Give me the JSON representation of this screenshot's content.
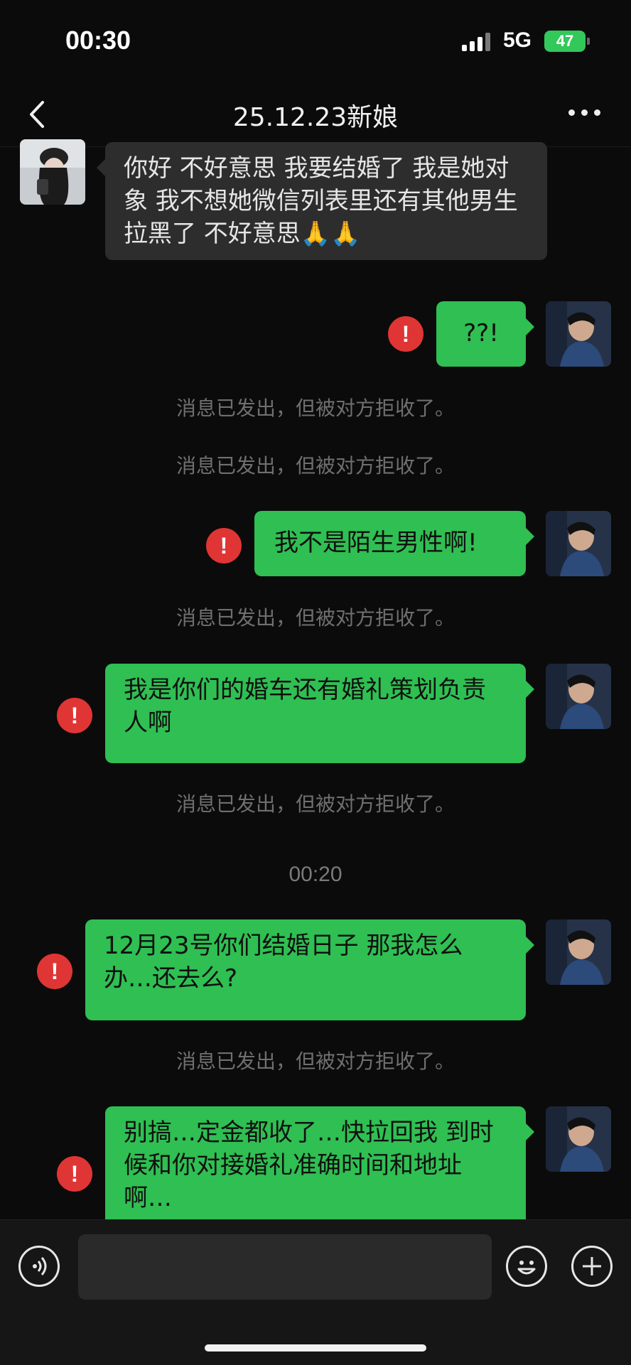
{
  "status_bar": {
    "time": "00:30",
    "network": "5G",
    "battery": "47"
  },
  "nav": {
    "title": "25.12.23新娘"
  },
  "messages": [
    {
      "side": "in",
      "text": "你好 不好意思 我要结婚了 我是她对象 我不想她微信列表里还有其他男生 拉黑了 不好意思🙏🙏"
    },
    {
      "side": "out",
      "text": "??!",
      "failed": true
    },
    {
      "system": "消息已发出，但被对方拒收了。"
    },
    {
      "system": "消息已发出，但被对方拒收了。"
    },
    {
      "side": "out",
      "text": "我不是陌生男性啊!",
      "failed": true
    },
    {
      "system": "消息已发出，但被对方拒收了。"
    },
    {
      "side": "out",
      "text": "我是你们的婚车还有婚礼策划负责人啊",
      "failed": true
    },
    {
      "system": "消息已发出，但被对方拒收了。"
    },
    {
      "timestamp": "00:20"
    },
    {
      "side": "out",
      "text": "12月23号你们结婚日子 那我怎么办…还去么?",
      "failed": true
    },
    {
      "system": "消息已发出，但被对方拒收了。"
    },
    {
      "side": "out",
      "text": "别搞…定金都收了…快拉回我 到时候和你对接婚礼准确时间和地址啊…",
      "failed": true
    }
  ],
  "error_symbol": "!",
  "input_bar": {
    "voice_icon": "voice-icon",
    "emoji_icon": "emoji-icon",
    "plus_icon": "plus-icon"
  },
  "colors": {
    "sent_bubble": "#2fbf52",
    "received_bubble": "#2d2d2d",
    "error": "#e03535",
    "background": "#0b0b0b"
  }
}
